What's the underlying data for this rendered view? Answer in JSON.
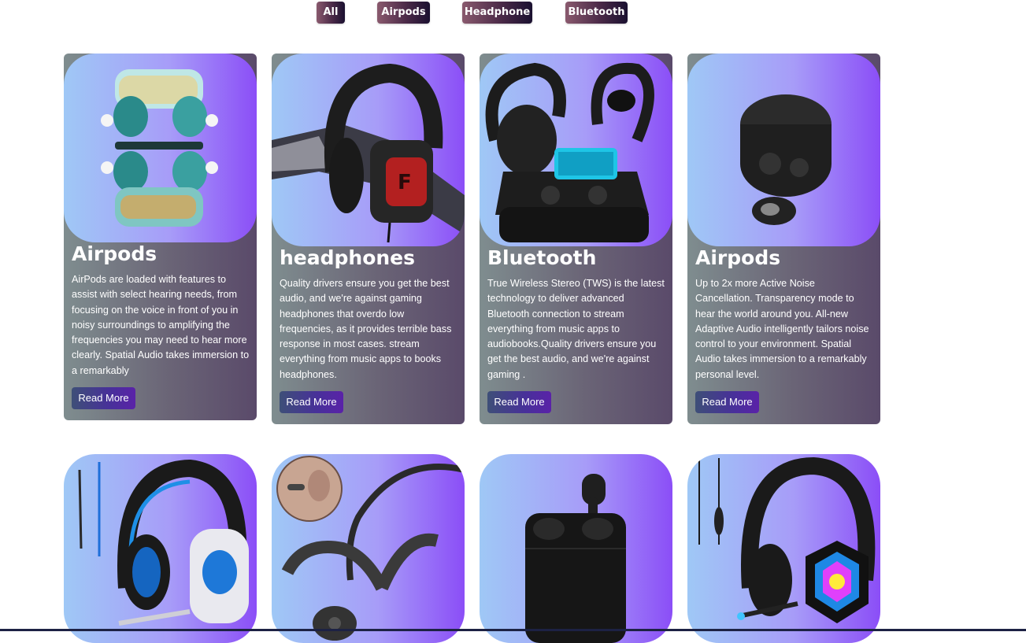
{
  "filters": {
    "all": "All",
    "airpods": "Airpods",
    "headphone": "Headphone",
    "bluetooth": "Bluetooth"
  },
  "cards": [
    {
      "title": "Airpods",
      "description": "AirPods are loaded with features to assist with select hearing needs, from focusing on the voice in front of you in noisy surroundings to amplifying the frequencies you may need to hear more clearly. Spatial Audio takes immersion to a remarkably",
      "button": "Read More",
      "image_icon": "airpods-icon"
    },
    {
      "title": "headphones",
      "description": "Quality drivers ensure you get the best audio, and we're against gaming headphones that overdo low frequencies, as it provides terrible bass response in most cases. stream everything from music apps to books headphones.",
      "button": "Read More",
      "image_icon": "gaming-headset-icon"
    },
    {
      "title": "Bluetooth",
      "description": "True Wireless Stereo (TWS) is the latest technology to deliver advanced Bluetooth connection to stream everything from music apps to audiobooks.Quality drivers ensure you get the best audio, and we're against gaming .",
      "button": "Read More",
      "image_icon": "sport-earbuds-icon"
    },
    {
      "title": "Airpods",
      "description": "Up to 2x more Active Noise Cancellation. Transparency mode to hear the world around you. All-new Adaptive Audio intelligently tailors noise control to your environment. Spatial Audio takes immersion to a remarkably personal level.",
      "button": "Read More",
      "image_icon": "earbuds-case-icon"
    }
  ],
  "second_row_images": [
    "blue-gaming-headset-icon",
    "bone-conduction-headphones-icon",
    "black-earbuds-case-icon",
    "rgb-gaming-headset-icon"
  ],
  "colors": {
    "filter_gradient": [
      "#8a5a6e",
      "#1a1030"
    ],
    "card_image_gradient": [
      "#9fc8f6",
      "#8b4ef7"
    ],
    "card_body_gradient": [
      "#7f8d8f",
      "#5a4a6a"
    ],
    "button_gradient": [
      "#3e4f78",
      "#5a22a8"
    ]
  }
}
